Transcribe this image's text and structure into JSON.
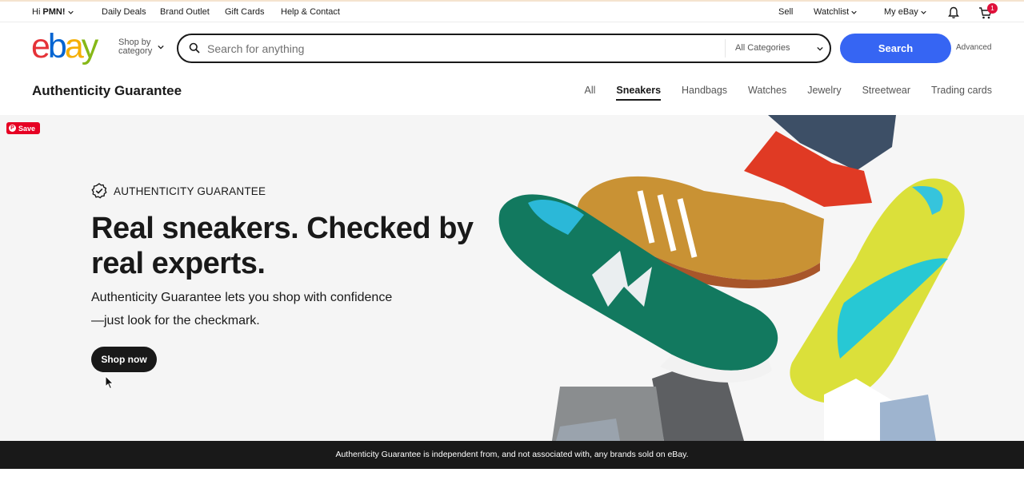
{
  "topbar": {
    "greeting_prefix": "Hi ",
    "greeting_name": "PMN!",
    "links": [
      "Daily Deals",
      "Brand Outlet",
      "Gift Cards",
      "Help & Contact"
    ],
    "sell": "Sell",
    "watchlist": "Watchlist",
    "my_ebay": "My eBay",
    "cart_count": "1",
    "icons": {
      "notification": "bell-icon",
      "cart": "cart-icon"
    }
  },
  "header": {
    "logo_letters": [
      "e",
      "b",
      "a",
      "y"
    ],
    "logo_colors": [
      "#e53238",
      "#0064d2",
      "#f5af02",
      "#86b817"
    ],
    "shop_by_line1": "Shop by",
    "shop_by_line2": "category",
    "search_placeholder": "Search for anything",
    "category_select": "All Categories",
    "search_button": "Search",
    "advanced": "Advanced",
    "accent": "#3665f3"
  },
  "subnav": {
    "title": "Authenticity Guarantee",
    "tabs": [
      "All",
      "Sneakers",
      "Handbags",
      "Watches",
      "Jewelry",
      "Streetwear",
      "Trading cards"
    ],
    "active_tab": "Sneakers"
  },
  "hero": {
    "pin_save": "Save",
    "badge": "AUTHENTICITY GUARANTEE",
    "title": "Real sneakers. Checked by real experts.",
    "description": "Authenticity Guarantee lets you shop with confidence—just look for the checkmark.",
    "cta": "Shop now"
  },
  "disclaimer": "Authenticity Guarantee is independent from, and not associated with, any brands sold on eBay."
}
